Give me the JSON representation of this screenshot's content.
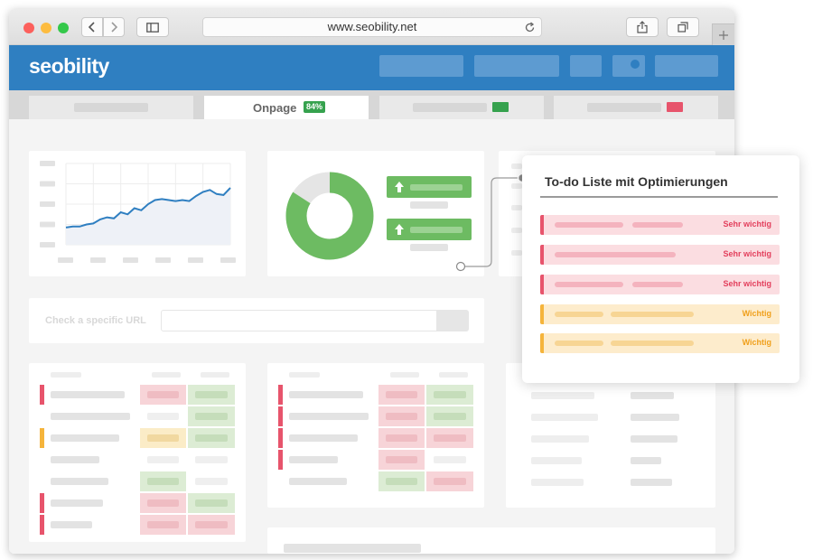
{
  "browser": {
    "url": "www.seobility.net",
    "colors": {
      "close": "#fc605c",
      "minimize": "#fdbc40",
      "zoom": "#34c84a"
    }
  },
  "app": {
    "logo": "seobility",
    "header_color": "#2f7fc1"
  },
  "tabs": {
    "onpage_label": "Onpage",
    "onpage_badge": "84%",
    "tab3_status_color": "#36a24e",
    "tab4_status_color": "#e7546c"
  },
  "url_check": {
    "label": "Check a specific URL",
    "value": ""
  },
  "chart_data": {
    "type": "line",
    "x": [
      1,
      2,
      3,
      4,
      5,
      6,
      7,
      8,
      9,
      10,
      11,
      12,
      13,
      14,
      15,
      16,
      17,
      18,
      19,
      20,
      21,
      22,
      23,
      24,
      25
    ],
    "values": [
      17,
      18,
      18,
      20,
      21,
      25,
      27,
      26,
      32,
      30,
      36,
      34,
      40,
      44,
      45,
      44,
      43,
      44,
      43,
      48,
      52,
      54,
      50,
      49,
      56
    ],
    "ylim": [
      0,
      80
    ],
    "grid": true,
    "color": "#2f7fc1"
  },
  "donut": {
    "value": 84,
    "colors": {
      "main": "#6dbb62",
      "rest": "#e5e5e5"
    }
  },
  "todo": {
    "title": "To-do Liste mit Optimierungen",
    "items": [
      {
        "label": "Sehr wichtig",
        "level": "high"
      },
      {
        "label": "Sehr wichtig",
        "level": "high"
      },
      {
        "label": "Sehr wichtig",
        "level": "high"
      },
      {
        "label": "Wichtig",
        "level": "medium"
      },
      {
        "label": "Wichtig",
        "level": "medium"
      }
    ],
    "colors": {
      "high": "#e7546c",
      "medium": "#f5b43b"
    }
  }
}
